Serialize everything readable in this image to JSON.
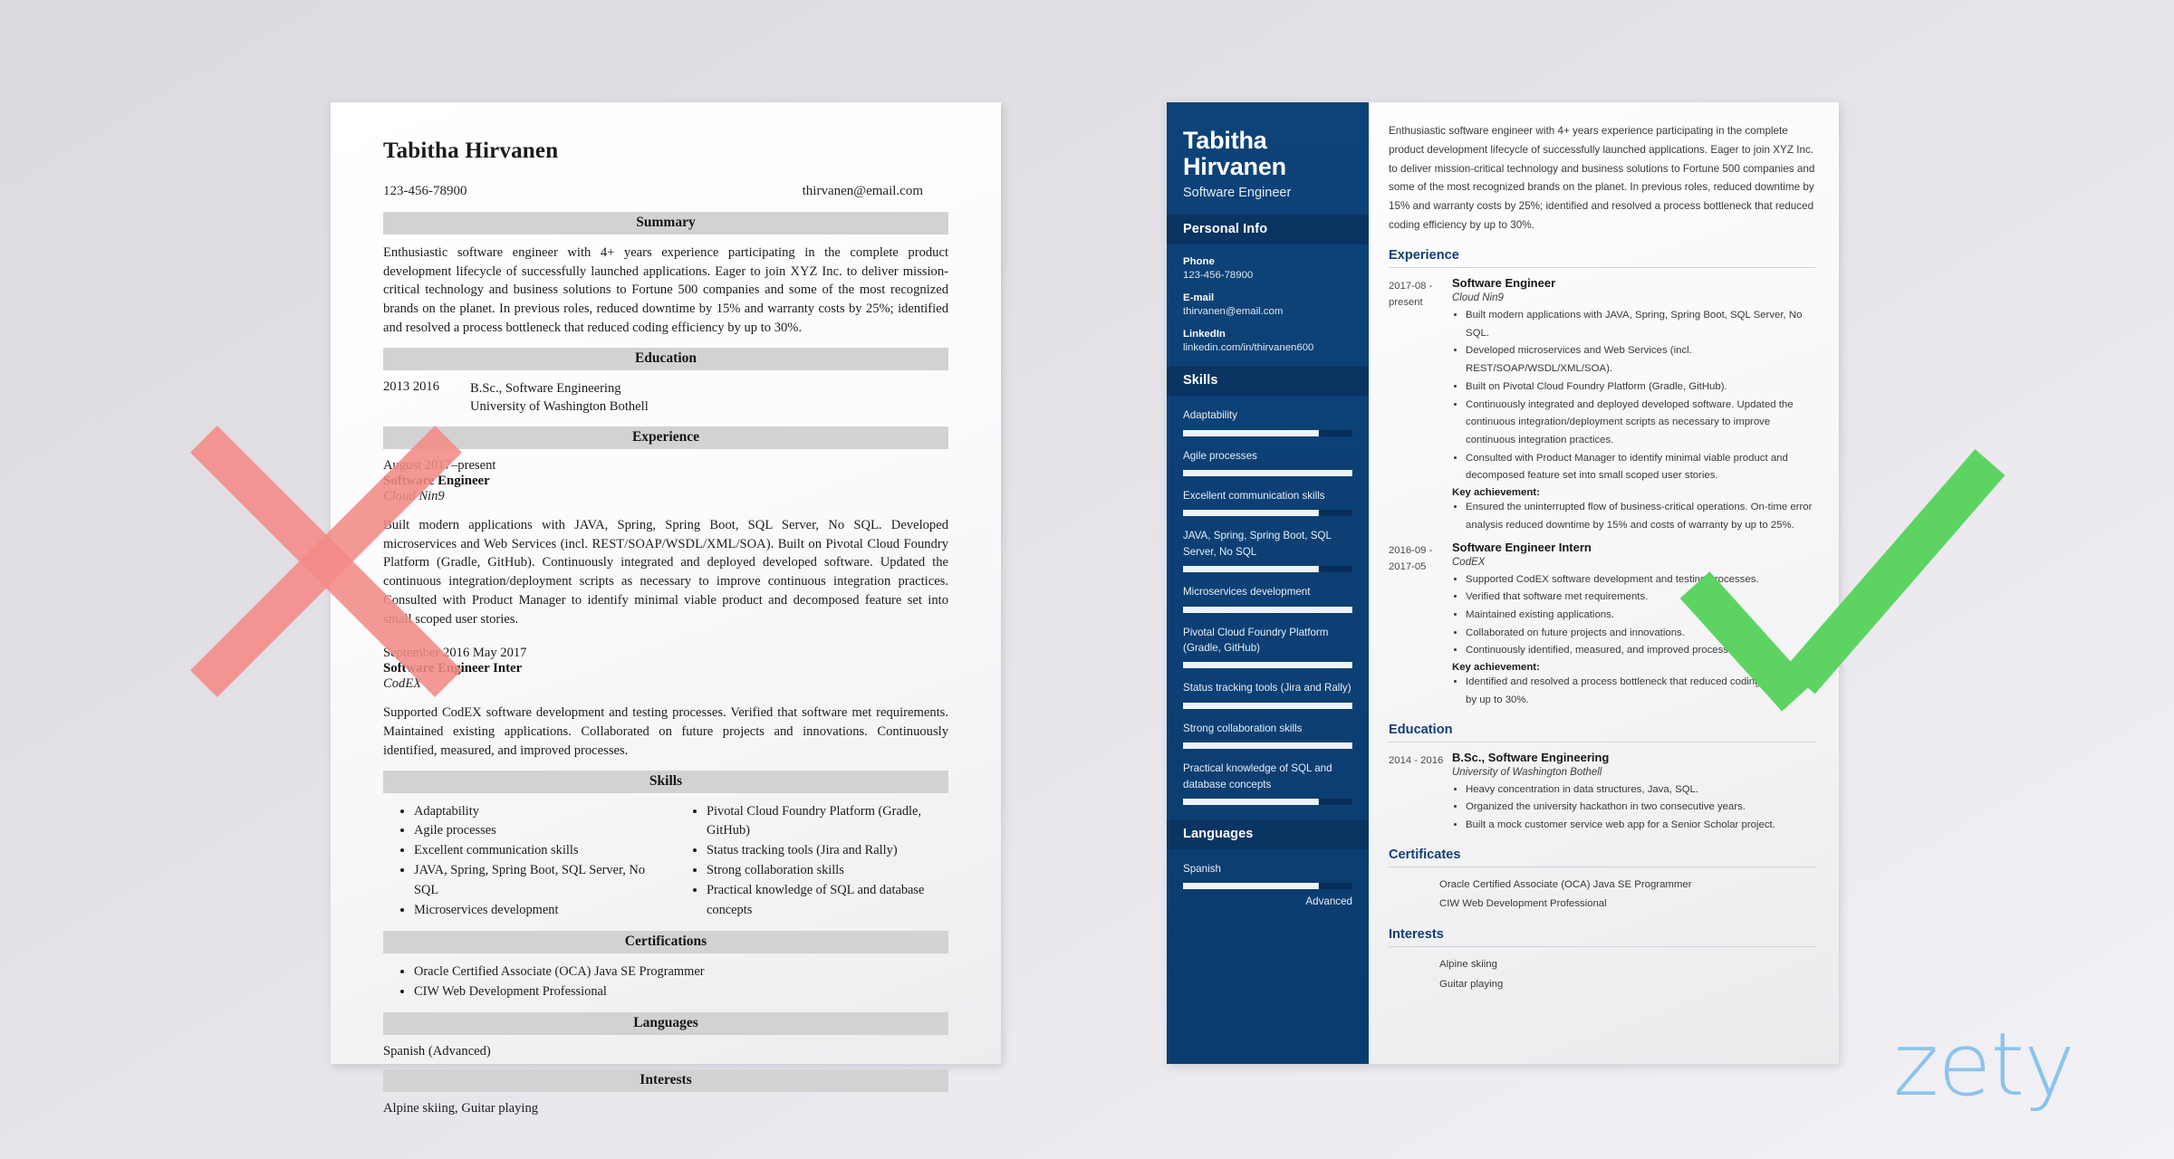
{
  "background": {
    "page_bg": "#dcdade",
    "accent_blue": "#0d4379",
    "x_color": "#f38a87",
    "check_color": "#5dd462",
    "logo_color": "#8cc3ec"
  },
  "logo": {
    "text": "zety"
  },
  "bad_resume": {
    "name": "Tabitha Hirvanen",
    "phone": "123-456-78900",
    "email": "thirvanen@email.com",
    "sections": {
      "summary": "Summary",
      "education": "Education",
      "experience": "Experience",
      "skills": "Skills",
      "certifications": "Certifications",
      "languages": "Languages",
      "interests": "Interests"
    },
    "summary_text": "Enthusiastic software engineer with 4+ years experience participating in the complete product development lifecycle of successfully launched applications. Eager to join XYZ Inc. to deliver mission-critical technology and business solutions to Fortune 500 companies and some of the most recognized brands on the planet. In previous roles, reduced downtime by 15% and warranty costs by 25%; identified and resolved a process bottleneck that reduced coding efficiency by up to 30%.",
    "education": {
      "dates": "2013  2016",
      "degree": "B.Sc., Software Engineering",
      "school": "University of Washington Bothell"
    },
    "jobs": [
      {
        "dates": "August 2017–present",
        "title": "Software Engineer",
        "company": "Cloud Nin9",
        "text": "Built modern applications with JAVA, Spring, Spring Boot, SQL Server, No SQL. Developed microservices and Web Services (incl. REST/SOAP/WSDL/XML/SOA). Built on Pivotal Cloud Foundry Platform (Gradle, GitHub). Continuously integrated and deployed developed software. Updated the continuous integration/deployment scripts as necessary to improve continuous integration practices. Consulted with Product Manager to identify minimal viable product and decomposed feature set into small scoped user stories."
      },
      {
        "dates": "September 2016  May 2017",
        "title": "Software Engineer Inter",
        "company": "CodEX",
        "text": "Supported CodEX software development and testing processes. Verified that software met requirements. Maintained existing applications. Collaborated on future projects and innovations. Continuously identified, measured, and improved processes."
      }
    ],
    "skills_col1": [
      "Adaptability",
      "Agile processes",
      "Excellent communication skills",
      "JAVA, Spring, Spring Boot, SQL Server, No SQL",
      "Microservices development"
    ],
    "skills_col2": [
      "Pivotal Cloud Foundry Platform (Gradle, GitHub)",
      "Status tracking tools (Jira and Rally)",
      "Strong collaboration skills",
      "Practical knowledge of SQL and database concepts"
    ],
    "certifications": [
      "Oracle Certified Associate (OCA) Java SE Programmer",
      "CIW Web Development Professional"
    ],
    "languages_text": "Spanish (Advanced)",
    "interests_text": "Alpine skiing, Guitar playing"
  },
  "good_resume": {
    "sidebar": {
      "name": "Tabitha Hirvanen",
      "role": "Software Engineer",
      "personal_info_heading": "Personal Info",
      "fields": [
        {
          "label": "Phone",
          "value": "123-456-78900"
        },
        {
          "label": "E-mail",
          "value": "thirvanen@email.com"
        },
        {
          "label": "LinkedIn",
          "value": "linkedin.com/in/thirvanen600"
        }
      ],
      "skills_heading": "Skills",
      "skills": [
        {
          "label": "Adaptability",
          "level": 80
        },
        {
          "label": "Agile processes",
          "level": 100
        },
        {
          "label": "Excellent communication skills",
          "level": 80
        },
        {
          "label": "JAVA, Spring, Spring Boot, SQL Server, No SQL",
          "level": 80
        },
        {
          "label": "Microservices development",
          "level": 100
        },
        {
          "label": "Pivotal Cloud Foundry Platform (Gradle, GitHub)",
          "level": 100
        },
        {
          "label": "Status tracking tools (Jira and Rally)",
          "level": 100
        },
        {
          "label": "Strong collaboration skills",
          "level": 100
        },
        {
          "label": "Practical knowledge of SQL and database concepts",
          "level": 80
        }
      ],
      "languages_heading": "Languages",
      "language_name": "Spanish",
      "language_level": 80,
      "language_label": "Advanced"
    },
    "main": {
      "summary_text": "Enthusiastic software engineer with 4+ years experience participating in the complete product development lifecycle of successfully launched applications. Eager to join XYZ Inc. to deliver mission-critical technology and business solutions to Fortune 500 companies and some of the most recognized brands on the planet. In previous roles, reduced downtime by 15% and warranty costs by 25%; identified and resolved a process bottleneck that reduced coding efficiency by up to 30%.",
      "experience_heading": "Experience",
      "education_heading": "Education",
      "certificates_heading": "Certificates",
      "interests_heading": "Interests",
      "key_achievement_label": "Key achievement:",
      "jobs": [
        {
          "dates": "2017-08 - present",
          "title": "Software Engineer",
          "company": "Cloud Nin9",
          "bullets": [
            "Built modern applications with JAVA, Spring, Spring Boot, SQL Server, No SQL.",
            "Developed microservices and Web Services (incl. REST/SOAP/WSDL/XML/SOA).",
            "Built on Pivotal Cloud Foundry Platform (Gradle, GitHub).",
            "Continuously integrated and deployed developed software. Updated the continuous integration/deployment scripts as necessary to improve continuous integration practices.",
            "Consulted with Product Manager to identify minimal viable product and decomposed feature set into small scoped user stories."
          ],
          "achievements": [
            "Ensured the uninterrupted flow of business-critical operations. On-time error analysis reduced downtime by 15% and costs of warranty by up to 25%."
          ]
        },
        {
          "dates": "2016-09 - 2017-05",
          "title": "Software Engineer Intern",
          "company": "CodEX",
          "bullets": [
            "Supported CodEX software development and testing processes.",
            "Verified that software met requirements.",
            "Maintained existing applications.",
            "Collaborated on future projects and innovations.",
            "Continuously identified, measured, and improved processes."
          ],
          "achievements": [
            "Identified and resolved a process bottleneck that reduced coding efficiency by up to 30%."
          ]
        }
      ],
      "education": [
        {
          "dates": "2014 - 2016",
          "title": "B.Sc., Software Engineering",
          "school": "University of Washington Bothell",
          "bullets": [
            "Heavy concentration in data structures, Java, SQL.",
            "Organized the university hackathon in two consecutive years.",
            "Built a mock customer service web app for a Senior Scholar project."
          ]
        }
      ],
      "certificates": [
        "Oracle Certified Associate (OCA) Java SE Programmer",
        "CIW Web Development Professional"
      ],
      "interests": [
        "Alpine skiing",
        "Guitar playing"
      ]
    }
  }
}
